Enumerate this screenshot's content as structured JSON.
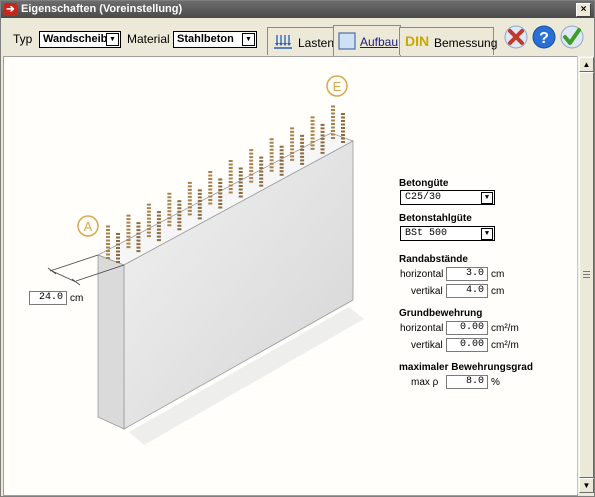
{
  "window": {
    "title": "Eigenschaften (Voreinstellung)",
    "close_glyph": "×"
  },
  "toolbar": {
    "typ_label": "Typ",
    "typ_value": "Wandscheibe",
    "material_label": "Material",
    "material_value": "Stahlbeton",
    "tabs": [
      {
        "label": "Lasten",
        "icon": "loads-icon"
      },
      {
        "label": "Aufbau",
        "icon": "structure-icon",
        "active": true
      },
      {
        "label": "Bemessung",
        "prefix": "DIN",
        "icon": "din-icon"
      }
    ],
    "actions": [
      {
        "name": "cancel",
        "icon": "cancel-icon",
        "color": "#c0392b"
      },
      {
        "name": "help",
        "icon": "help-icon",
        "color": "#2a6fd6"
      },
      {
        "name": "ok",
        "icon": "ok-icon",
        "color": "#3d9e2a"
      }
    ]
  },
  "drawing": {
    "start_marker": "A",
    "end_marker": "E",
    "thickness_value": "24.0",
    "thickness_unit": "cm",
    "marker_color": "#d7a84a"
  },
  "props": {
    "betongute_label": "Betongüte",
    "betongute_value": "C25/30",
    "betonstahl_label": "Betonstahlgüte",
    "betonstahl_value": "BSt 500",
    "rand_title": "Randabstände",
    "rand_h_label": "horizontal",
    "rand_h_value": "3.0",
    "rand_h_unit": "cm",
    "rand_v_label": "vertikal",
    "rand_v_value": "4.0",
    "rand_v_unit": "cm",
    "grund_title": "Grundbewehrung",
    "grund_h_label": "horizontal",
    "grund_h_value": "0.00",
    "grund_h_unit": "cm²/m",
    "grund_v_label": "vertikal",
    "grund_v_value": "0.00",
    "grund_v_unit": "cm²/m",
    "max_title": "maximaler Bewehrungsgrad",
    "max_label": "max ρ",
    "max_value": "8.0",
    "max_unit": "%"
  }
}
